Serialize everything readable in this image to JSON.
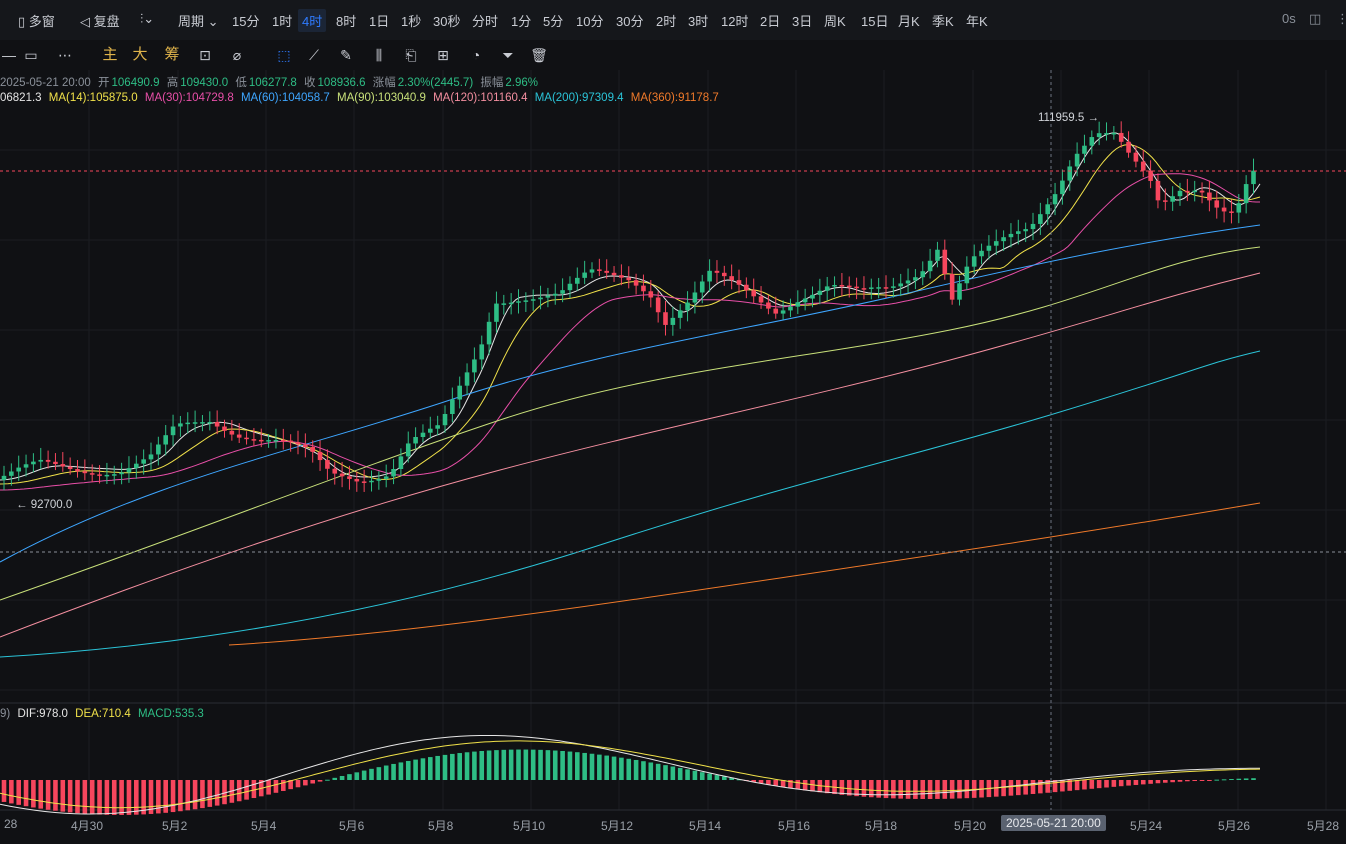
{
  "topbar": {
    "layout_label": "多窗",
    "replay_label": "复盘",
    "period_label": "周期",
    "intervals": [
      "15分",
      "1时",
      "4时",
      "8时",
      "1日",
      "1秒",
      "30秒",
      "分时",
      "1分",
      "5分",
      "10分",
      "30分",
      "2时",
      "3时",
      "12时",
      "2日",
      "3日",
      "周K",
      "15日",
      "月K",
      "季K",
      "年K"
    ],
    "active_interval": "4时",
    "right_value": "0s"
  },
  "toolbar": {
    "indicator_labels": [
      "主",
      "大",
      "筹"
    ]
  },
  "info": {
    "date": "2025-05-21 20:00",
    "open_label": "开",
    "open": "106490.9",
    "high_label": "高",
    "high": "109430.0",
    "low_label": "低",
    "low": "106277.8",
    "close_label": "收",
    "close": "108936.6",
    "change_label": "涨幅",
    "change": "2.30%(2445.7)",
    "amp_label": "振幅",
    "amp": "2.96%"
  },
  "ma": {
    "ma7": "06821.3",
    "ma14": "MA(14):105875.0",
    "ma30": "MA(30):104729.8",
    "ma60": "MA(60):104058.7",
    "ma90": "MA(90):103040.9",
    "ma120": "MA(120):101160.4",
    "ma200": "MA(200):97309.4",
    "ma360": "MA(360):91178.7"
  },
  "colors": {
    "up": "#2ebd85",
    "down": "#f6465d",
    "ma7": "#e6e6e6",
    "ma14": "#f0e14a",
    "ma30": "#e84fa8",
    "ma60": "#3ea6ff",
    "ma90": "#c8e07a",
    "ma120": "#f48fa0",
    "ma200": "#2bc4d8",
    "ma360": "#f07a2a"
  },
  "price_markers": {
    "high": "111959.5 →",
    "low": "← 92700.0"
  },
  "macd": {
    "prefix": "9)",
    "dif": "DIF:978.0",
    "dea": "DEA:710.4",
    "macd": "MACD:535.3"
  },
  "xaxis": {
    "labels": [
      "28",
      "4月30",
      "5月2",
      "5月4",
      "5月6",
      "5月8",
      "5月10",
      "5月12",
      "5月14",
      "5月16",
      "5月18",
      "5月20",
      "5月24",
      "5月26",
      "5月28"
    ],
    "crosshair_label": "2025-05-21 20:00"
  }
}
